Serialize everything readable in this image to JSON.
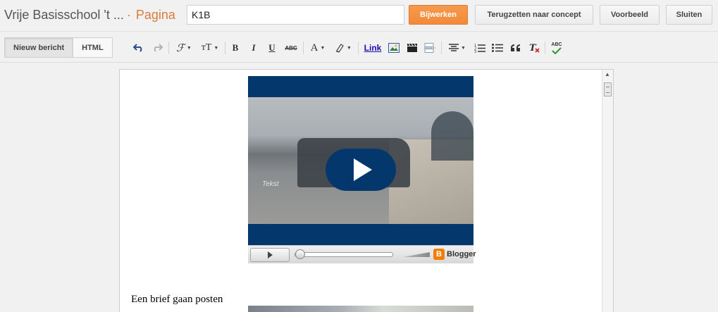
{
  "header": {
    "blog_title": "Vrije Basisschool 't ...",
    "separator": "·",
    "page_type": "Pagina",
    "title_value": "K1B",
    "buttons": {
      "update": "Bijwerken",
      "revert": "Terugzetten naar concept",
      "preview": "Voorbeeld",
      "close": "Sluiten"
    }
  },
  "toolbar": {
    "mode_tabs": [
      "Nieuw bericht",
      "HTML"
    ],
    "font_glyph": "ℱ",
    "size_glyph": "тT",
    "bold": "B",
    "italic": "I",
    "underline": "U",
    "strike": "ABC",
    "text_color": "A",
    "link": "Link",
    "spellcheck": "ABC"
  },
  "editor": {
    "video": {
      "caption": "Tekst",
      "logo_text": "Blogger"
    },
    "paragraph": "Een brief gaan posten"
  },
  "colors": {
    "accent": "#f28a3a",
    "video_bg": "#04386d",
    "link": "#1a0dab"
  }
}
